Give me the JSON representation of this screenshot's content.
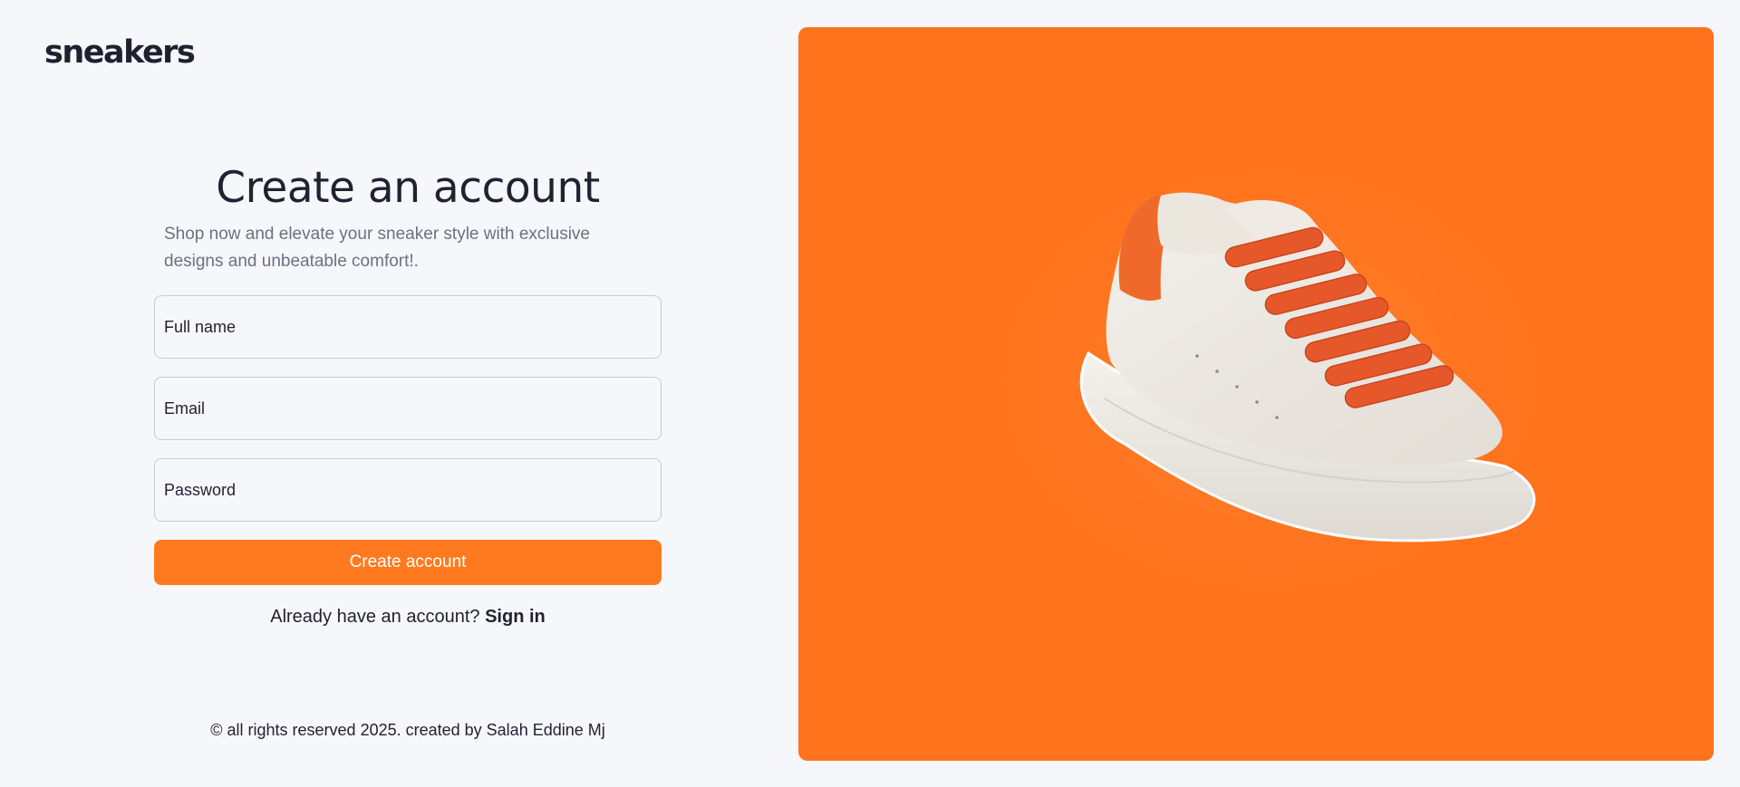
{
  "brand": {
    "logo_text": "sneakers"
  },
  "form": {
    "title": "Create an account",
    "subtitle": "Shop now and elevate your sneaker style with exclusive designs and unbeatable comfort!.",
    "full_name_placeholder": "Full name",
    "email_placeholder": "Email",
    "password_placeholder": "Password",
    "submit_label": "Create account",
    "signin_prompt": "Already have an account?",
    "signin_link": "Sign in"
  },
  "footer": {
    "text": "© all rights reserved 2025. created by Salah Eddine Mj"
  },
  "hero": {
    "image": "sneaker-image",
    "background_color": "#ff731c",
    "accent_color": "#ff7a1f"
  }
}
